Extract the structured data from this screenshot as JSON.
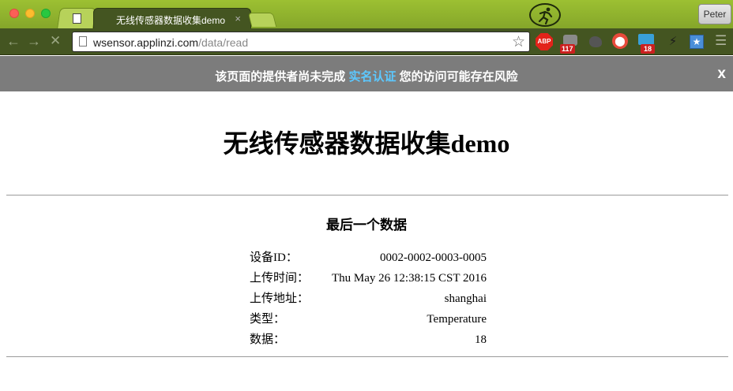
{
  "browser": {
    "tabs": [
      {
        "label": ""
      },
      {
        "label": "无线传感器数据收集demo",
        "close": "×"
      }
    ],
    "profile_button": "Peter",
    "nav": {
      "back": "←",
      "forward": "→",
      "stop": "✕"
    },
    "url": {
      "host": "wsensor.applinzi.com",
      "path": "/data/read"
    },
    "star": "☆",
    "menu": "☰",
    "extensions": [
      {
        "icon": "adblock-plus-icon",
        "label": "ABP"
      },
      {
        "icon": "mail-icon",
        "badge": "117"
      },
      {
        "icon": "hedgehog-icon"
      },
      {
        "icon": "red-circle-icon"
      },
      {
        "icon": "monitor-icon",
        "badge": "18"
      },
      {
        "icon": "lightning-icon"
      },
      {
        "icon": "bookmark-star-icon"
      }
    ]
  },
  "banner": {
    "text_before": "该页面的提供者尚未完成",
    "link": "实名认证",
    "text_after": "您的访问可能存在风险",
    "close": "x"
  },
  "page": {
    "title": "无线传感器数据收集demo",
    "section_title": "最后一个数据",
    "rows": [
      {
        "key": "设备ID：",
        "value": "0002-0002-0003-0005"
      },
      {
        "key": "上传时间：",
        "value": "Thu May 26 12:38:15 CST 2016"
      },
      {
        "key": "上传地址：",
        "value": "shanghai"
      },
      {
        "key": "类型：",
        "value": "Temperature"
      },
      {
        "key": "数据：",
        "value": "18"
      }
    ]
  },
  "colors": {
    "chrome_green": "#9cc032",
    "toolbar_dark": "#445521",
    "banner_gray": "#7c7c7c",
    "banner_link": "#5cc8ff"
  }
}
